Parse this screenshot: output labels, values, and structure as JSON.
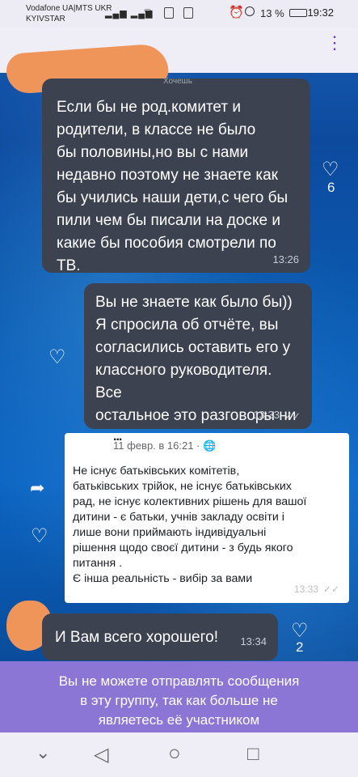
{
  "status_bar": {
    "carrier_line1": "Vodafone UA|MTS UKR",
    "carrier_line2": "KYIVSTAR",
    "battery": "13 %",
    "time": "19:32"
  },
  "messages": [
    {
      "sender": "Хочешь",
      "text": "Если бы не род.комитет и\nродители, в классе не было\nбы половины,но вы с нами\nнедавно поэтому не знаете как\nбы учились наши дети,с чего бы\nпили чем бы писали на доске и\nкакие бы пособия смотрели по\nТВ.",
      "time": "13:26",
      "reactions": "6"
    },
    {
      "text": "Вы не знаете как было бы))\nЯ спросила об отчёте, вы\nсогласились оставить его у\nклассного руководителя. Все\nостальное это разговоры ни о\nчем. Хорошего дня.",
      "time": "13:33",
      "ticks": "✓✓"
    }
  ],
  "shared_post": {
    "author": "...",
    "date": "11 февр. в 16:21 · ",
    "text": "Не існує батьківських комітетів,\nбатьківських трійок, не існує батьківських\nрад, не існує колективних рішень для вашої\nдитини - є батьки, учнів закладу освіти і\nлише вони приймають індивідуальні\nрішення щодо своєї дитини - з будь якого\nпитання .\nЄ інша реальність - вибір за вами",
    "time": "13:33",
    "ticks": "✓✓"
  },
  "last_message": {
    "text": "И Вам всего хорошего!",
    "time": "13:34",
    "reactions": "2"
  },
  "notice": {
    "text": "Вы не можете отправлять сообщения\nв эту группу, так как больше не\nявляетесь её участником"
  },
  "icons": {
    "menu": "⋮",
    "heart": "♡",
    "share": "➦",
    "back": "◁",
    "home": "○",
    "recents": "□",
    "collapse": "⌄"
  },
  "colors": {
    "bubble": "#3d4250",
    "notice": "#8b76d6",
    "accent": "#6b3fc2"
  }
}
